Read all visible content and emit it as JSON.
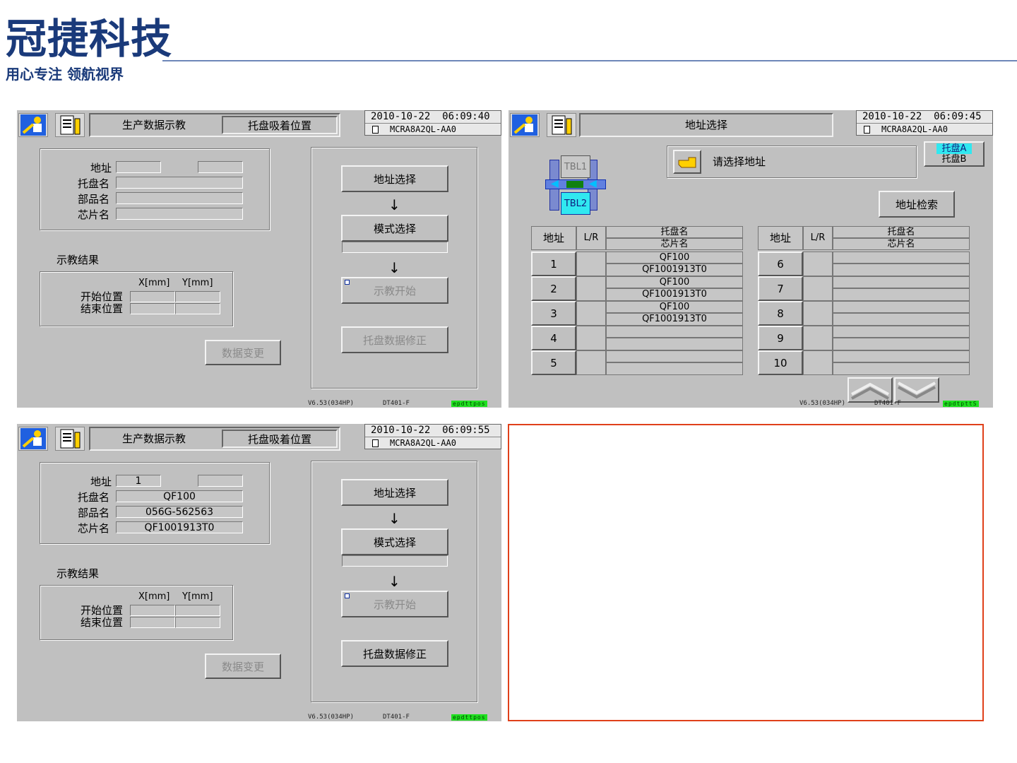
{
  "logo": {
    "title": "冠捷科技",
    "slogan": "用心专注 领航视界"
  },
  "screen1": {
    "tab_title": "生产数据示教",
    "tab_subtitle": "托盘吸着位置",
    "datetime": "2010-10-22  06:09:40",
    "model": "MCRA8A2QL-AA0",
    "labels": {
      "address": "地址",
      "tray_name": "托盘名",
      "part_name": "部品名",
      "chip_name": "芯片名"
    },
    "values": {
      "address": "",
      "address_extra": "",
      "tray_name": "",
      "part_name": "",
      "chip_name": ""
    },
    "result_title": "示教结果",
    "col_x": "X[mm]",
    "col_y": "Y[mm]",
    "start_pos": "开始位置",
    "end_pos": "结束位置",
    "data_change": "数据变更",
    "btn_address": "地址选择",
    "btn_mode": "模式选择",
    "btn_teach": "示教开始",
    "btn_tray_fix": "托盘数据修正",
    "version": "V6.53(034HP)",
    "device": "DT401-F",
    "status": "epdttpos"
  },
  "screen2": {
    "tab_title": "地址选择",
    "datetime": "2010-10-22  06:09:45",
    "model": "MCRA8A2QL-AA0",
    "tbl1": "TBL1",
    "tbl2": "TBL2",
    "prompt": "请选择地址",
    "tray_a": "托盘A",
    "tray_b": "托盘B",
    "search": "地址检索",
    "headers": {
      "address": "地址",
      "lr": "L/R",
      "tray_name": "托盘名",
      "chip_name": "芯片名"
    },
    "left_rows": [
      {
        "addr": "1",
        "tray": "QF100",
        "chip": "QF1001913T0"
      },
      {
        "addr": "2",
        "tray": "QF100",
        "chip": "QF1001913T0"
      },
      {
        "addr": "3",
        "tray": "QF100",
        "chip": "QF1001913T0"
      },
      {
        "addr": "4",
        "tray": "",
        "chip": ""
      },
      {
        "addr": "5",
        "tray": "",
        "chip": ""
      }
    ],
    "right_rows": [
      {
        "addr": "6",
        "tray": "",
        "chip": ""
      },
      {
        "addr": "7",
        "tray": "",
        "chip": ""
      },
      {
        "addr": "8",
        "tray": "",
        "chip": ""
      },
      {
        "addr": "9",
        "tray": "",
        "chip": ""
      },
      {
        "addr": "10",
        "tray": "",
        "chip": ""
      }
    ],
    "version": "V6.53(034HP)",
    "device": "DT401-F",
    "status": "epdtpttS"
  },
  "screen3": {
    "tab_title": "生产数据示教",
    "tab_subtitle": "托盘吸着位置",
    "datetime": "2010-10-22  06:09:55",
    "model": "MCRA8A2QL-AA0",
    "values": {
      "address": "1",
      "address_extra": "",
      "tray_name": "QF100",
      "part_name": "056G-562563",
      "chip_name": "QF1001913T0"
    },
    "version": "V6.53(034HP)",
    "device": "DT401-F",
    "status": "epdttpos"
  },
  "colors": {
    "accent_border": "#e0401a",
    "brand_blue": "#1a3a7a",
    "screen_bg": "#c0c0c0"
  }
}
